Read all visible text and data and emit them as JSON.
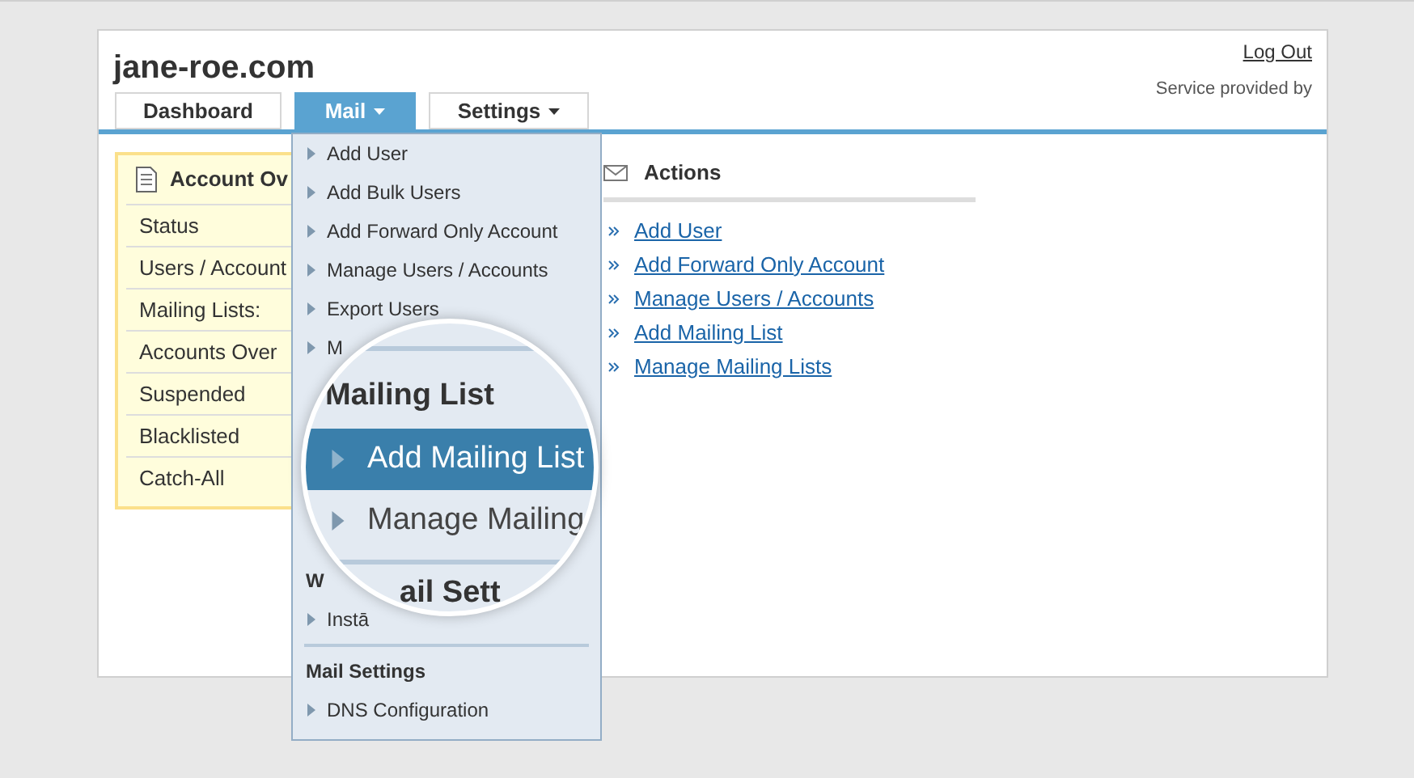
{
  "header": {
    "site": "jane-roe.com",
    "logout": "Log Out",
    "service": "Service provided by"
  },
  "tabs": [
    {
      "label": "Dashboard",
      "selected": false,
      "dropdown": false
    },
    {
      "label": "Mail",
      "selected": true,
      "dropdown": true
    },
    {
      "label": "Settings",
      "selected": false,
      "dropdown": true
    }
  ],
  "overview": {
    "title": "Account Ov",
    "rows": [
      "Status",
      "Users / Account",
      "Mailing Lists:",
      "Accounts Over",
      "Suspended",
      "Blacklisted",
      "Catch-All"
    ]
  },
  "actions": {
    "title": "Actions",
    "links": [
      "Add User",
      "Add Forward Only Account",
      "Manage Users / Accounts",
      "Add Mailing List",
      "Manage Mailing Lists"
    ]
  },
  "menu": {
    "items_above": [
      {
        "kind": "link",
        "label": "Add User"
      },
      {
        "kind": "link",
        "label": "Add Bulk Users"
      },
      {
        "kind": "link",
        "label": "Add Forward Only Account"
      },
      {
        "kind": "link",
        "label": "Manage Users / Accounts"
      },
      {
        "kind": "link",
        "label": "Export Users"
      },
      {
        "kind": "link",
        "label": "M"
      }
    ],
    "items_below": [
      {
        "kind": "heading",
        "label": "W"
      },
      {
        "kind": "link",
        "label": "Instā"
      },
      {
        "kind": "divider"
      },
      {
        "kind": "heading",
        "label": "Mail Settings"
      },
      {
        "kind": "link",
        "label": "DNS Configuration"
      }
    ]
  },
  "magnifier": {
    "items": [
      {
        "kind": "divider"
      },
      {
        "kind": "heading",
        "label": "Mailing List"
      },
      {
        "kind": "link",
        "label": "Add Mailing List",
        "selected": true
      },
      {
        "kind": "link",
        "label": "Manage Mailing",
        "selected": false
      },
      {
        "kind": "divider"
      },
      {
        "kind": "heading",
        "label": "ail Sett"
      }
    ]
  }
}
